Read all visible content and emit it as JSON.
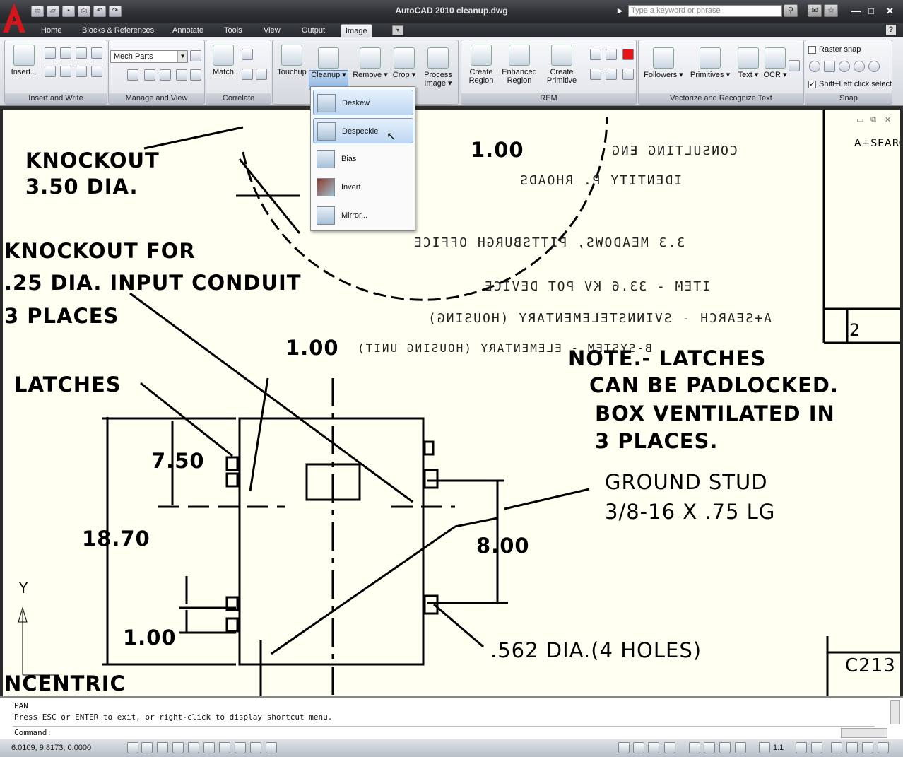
{
  "window": {
    "title": "AutoCAD 2010   cleanup.dwg",
    "search_placeholder": "Type a keyword or phrase"
  },
  "tabs": [
    "Home",
    "Blocks & References",
    "Annotate",
    "Tools",
    "View",
    "Output",
    "Image"
  ],
  "active_tab": "Image",
  "ribbon": {
    "insert_label": "Insert...",
    "insert_panel": "Insert and Write",
    "combo_value": "Mech Parts",
    "manage_panel": "Manage and View",
    "match_label": "Match",
    "correlate_panel": "Correlate",
    "touchup_label": "Touchup",
    "cleanup_label": "Cleanup",
    "remove_label": "Remove",
    "crop_label": "Crop",
    "process_label": "Process Image",
    "create_region": "Create Region",
    "enhanced_region": "Enhanced Region",
    "create_primitive": "Create Primitive",
    "rem_panel": "REM",
    "followers_label": "Followers",
    "primitives_label": "Primitives",
    "text_label": "Text",
    "ocr_label": "OCR",
    "vectorize_panel": "Vectorize and Recognize Text",
    "raster_snap": "Raster snap",
    "shift_select": "Shift+Left click select",
    "snap_panel": "Snap"
  },
  "cleanup_menu": [
    {
      "label": "Deskew",
      "icon": "deskew-icon"
    },
    {
      "label": "Despeckle",
      "icon": "despeckle-icon"
    },
    {
      "label": "Bias",
      "icon": "bias-icon"
    },
    {
      "label": "Invert",
      "icon": "invert-icon"
    },
    {
      "label": "Mirror...",
      "icon": "mirror-icon"
    }
  ],
  "drawing": {
    "knockout1_a": "KNOCKOUT",
    "knockout1_b": "3.50 DIA.",
    "knockout2_a": "KNOCKOUT  FOR",
    "knockout2_b": ".25 DIA. INPUT CONDUIT",
    "knockout2_c": "3 PLACES",
    "latches": "LATCHES",
    "dim_750": "7.50",
    "dim_1870": "18.70",
    "dim_100a": "1.00",
    "dim_100b": "1.00",
    "dim_100c": "1.00",
    "dim_800": "8.00",
    "note_a": "NOTE.- LATCHES",
    "note_b": "CAN BE PADLOCKED.",
    "note_c": "BOX VENTILATED IN",
    "note_d": "3 PLACES.",
    "ground_a": "GROUND  STUD",
    "ground_b": "3/8-16  X  .75 LG",
    "holes": ".562 DIA.(4 HOLES)",
    "concentric": "NCENTRIC",
    "sheet_no": "C213",
    "rev": "2",
    "m1": "A+SEARCH - SVINNSTELEMENTARY (HOUSING)",
    "m2": "ITEM - 33.6 KV POT DEVICE",
    "m3": "3.3 MEADOWS, PITTSBURGH OFFICE",
    "m4": "CONSULTING ENG",
    "m5": "IDENTITY P. RHOADS",
    "m6": "B-SYSTEM - ELEMENTARY (HOUSING UNIT)"
  },
  "command": {
    "line1": "PAN",
    "line2": "Press ESC or ENTER to exit, or right-click to display shortcut menu.",
    "prompt": "Command:"
  },
  "status": {
    "coords": "6.0109, 9.8173, 0.0000",
    "scale": "1:1"
  }
}
